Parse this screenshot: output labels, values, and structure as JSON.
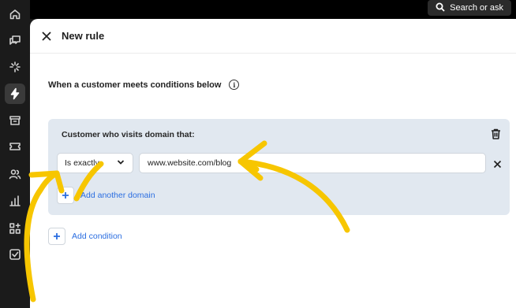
{
  "topbar": {
    "search_label": "Search or ask",
    "search_icon": "search-icon"
  },
  "rail": {
    "items": [
      {
        "name": "home",
        "icon": "home-icon"
      },
      {
        "name": "conversations",
        "icon": "chat-icon"
      },
      {
        "name": "ai",
        "icon": "sparkle-icon"
      },
      {
        "name": "automation",
        "icon": "lightning-icon",
        "active": true
      },
      {
        "name": "archive",
        "icon": "archive-icon"
      },
      {
        "name": "tickets",
        "icon": "ticket-icon"
      },
      {
        "name": "customers",
        "icon": "users-icon"
      },
      {
        "name": "reports",
        "icon": "bar-chart-icon"
      },
      {
        "name": "apps",
        "icon": "apps-icon"
      },
      {
        "name": "tasks",
        "icon": "checkbox-icon"
      }
    ]
  },
  "header": {
    "title": "New rule"
  },
  "conditions": {
    "heading": "When a customer meets conditions below",
    "info_glyph": "i",
    "card": {
      "title": "Customer who visits domain that:",
      "operator": "Is exactly",
      "domain_value": "www.website.com/blog",
      "add_domain_label": "Add another domain"
    },
    "add_condition_label": "Add condition"
  },
  "colors": {
    "accent": "#2a6de0",
    "card_bg": "#e1e8f0",
    "annotation": "#f7c600",
    "rail_bg": "#1b1b1b"
  }
}
